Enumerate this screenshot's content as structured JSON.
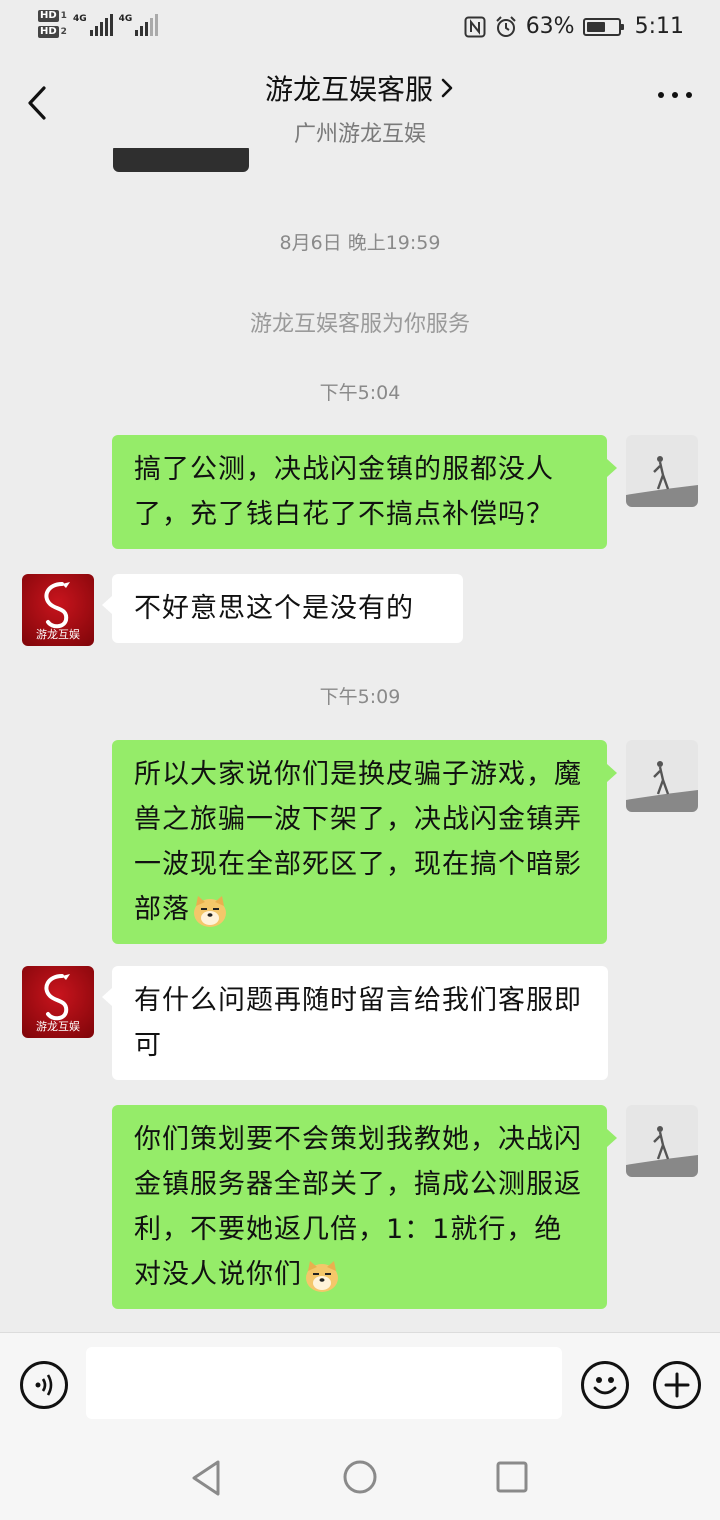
{
  "status_bar": {
    "sim1": "HD",
    "sim1_num": "1",
    "sim2": "HD",
    "sim2_num": "2",
    "net1": "4G",
    "net2": "4G",
    "battery_percent": "63%",
    "battery_level": 0.63,
    "time": "5:11"
  },
  "header": {
    "title": "游龙互娱客服",
    "subtitle": "广州游龙互娱"
  },
  "chat": {
    "timestamp_1": "8月6日 晚上19:59",
    "system_message": "游龙互娱客服为你服务",
    "timestamp_2": "下午5:04",
    "msg_1": "搞了公测，决战闪金镇的服都没人了，充了钱白花了不搞点补偿吗？",
    "msg_2": "不好意思这个是没有的",
    "timestamp_3": "下午5:09",
    "msg_3": "所以大家说你们是换皮骗子游戏，魔兽之旅骗一波下架了，决战闪金镇弄一波现在全部死区了，现在搞个暗影部落",
    "msg_4": "有什么问题再随时留言给我们客服即可",
    "msg_5": "你们策划要不会策划我教她，决战闪金镇服务器全部关了，搞成公测服返利，不要她返几倍，1：1就行，绝对没人说你们",
    "avatar_them_text": "游龙互娱"
  },
  "colors": {
    "my_bubble": "#95ec69",
    "their_bubble": "#ffffff",
    "background": "#ededed",
    "brand_red": "#c8141d"
  },
  "icons": {
    "back": "chevron-left-icon",
    "title_arrow": "chevron-right-icon",
    "more": "more-dots-icon",
    "voice": "voice-icon",
    "emoji": "smiley-icon",
    "add": "plus-icon",
    "nav_back": "nav-back-icon",
    "nav_home": "nav-home-icon",
    "nav_recent": "nav-recent-icon",
    "alarm": "alarm-icon",
    "nfc": "nfc-icon",
    "inline_emoji": "doge-emoji-icon"
  }
}
